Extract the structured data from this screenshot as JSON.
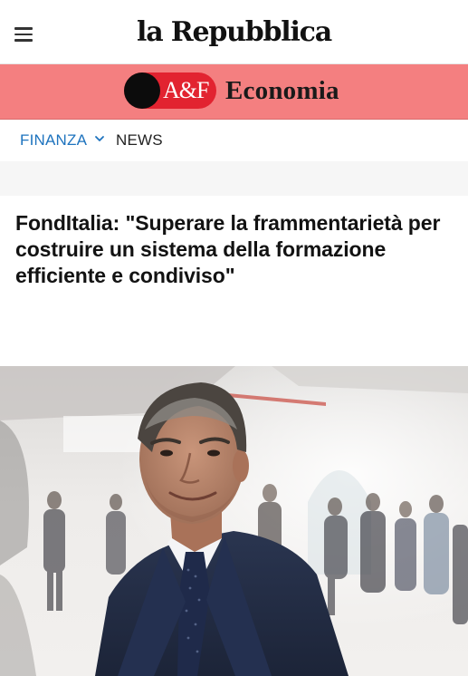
{
  "header": {
    "menu_icon": "hamburger-menu-icon",
    "logo_text": "la Repubblica"
  },
  "section": {
    "badge_text": "A&F",
    "title": "Economia",
    "colors": {
      "band": "#f47f80",
      "badge": "#e22330",
      "dot": "#0c0c0c"
    }
  },
  "subnav": {
    "items": [
      {
        "label": "FINANZA",
        "has_dropdown": true,
        "color": "#1e73be"
      },
      {
        "label": "NEWS",
        "has_dropdown": false,
        "color": "#222222"
      }
    ]
  },
  "article": {
    "headline": "FondItalia: \"Superare la frammentarietà per costruire un sistema della formazione efficiente e condiviso\"",
    "image": "portrait-photo"
  }
}
